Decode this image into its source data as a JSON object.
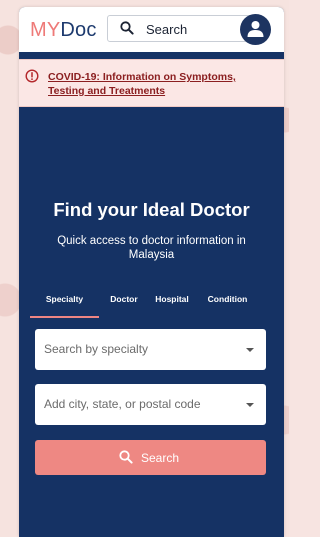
{
  "header": {
    "logo_my": "MY",
    "logo_doc": "Doc",
    "search_label": "Search"
  },
  "alert": {
    "text": "COVID-19: Information on Symptoms, Testing and Treatments"
  },
  "hero": {
    "title": "Find your Ideal Doctor",
    "subtitle": "Quick access to doctor information in Malaysia"
  },
  "tabs": [
    {
      "label": "Specialty",
      "active": true
    },
    {
      "label": "Doctor",
      "active": false
    },
    {
      "label": "Hospital",
      "active": false
    },
    {
      "label": "Condition",
      "active": false
    }
  ],
  "form": {
    "specialty_placeholder": "Search by specialty",
    "location_placeholder": "Add city, state, or postal code",
    "submit_label": "Search"
  },
  "colors": {
    "brand_coral": "#ee7a78",
    "brand_navy": "#153264",
    "alert_text": "#8b1f20"
  }
}
